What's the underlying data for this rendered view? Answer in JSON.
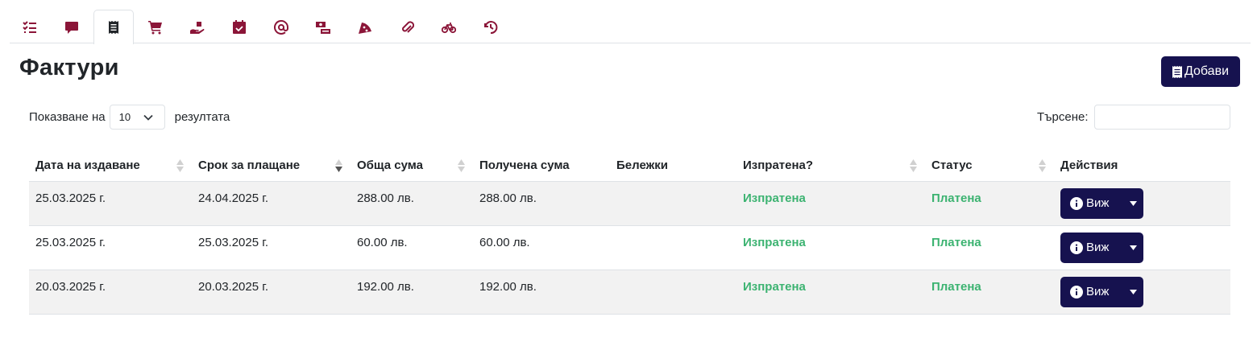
{
  "tabs": [
    {
      "icon": "tasks-icon",
      "active": false
    },
    {
      "icon": "comment-icon",
      "active": false
    },
    {
      "icon": "invoice-icon",
      "active": true
    },
    {
      "icon": "cart-icon",
      "active": false
    },
    {
      "icon": "hand-holding-icon",
      "active": false
    },
    {
      "icon": "calendar-check-icon",
      "active": false
    },
    {
      "icon": "at-icon",
      "active": false
    },
    {
      "icon": "money-transfer-icon",
      "active": false
    },
    {
      "icon": "pizza-icon",
      "active": false
    },
    {
      "icon": "paperclip-icon",
      "active": false
    },
    {
      "icon": "bicycle-icon",
      "active": false
    },
    {
      "icon": "history-icon",
      "active": false
    }
  ],
  "page": {
    "title": "Фактури",
    "add_label": "Добави"
  },
  "length": {
    "prefix": "Показване на",
    "value": "10",
    "suffix": "резултата"
  },
  "search": {
    "label": "Търсене:",
    "value": ""
  },
  "table": {
    "headers": [
      "Дата на издаване",
      "Срок за плащане",
      "Обща сума",
      "Получена сума",
      "Бележки",
      "Изпратена?",
      "Статус",
      "Действия"
    ],
    "rows": [
      {
        "issued": "25.03.2025 г.",
        "due": "24.04.2025 г.",
        "total": "288.00 лв.",
        "received": "288.00 лв.",
        "notes": "",
        "sent": "Изпратена",
        "status": "Платена",
        "action": "Виж"
      },
      {
        "issued": "25.03.2025 г.",
        "due": "25.03.2025 г.",
        "total": "60.00 лв.",
        "received": "60.00 лв.",
        "notes": "",
        "sent": "Изпратена",
        "status": "Платена",
        "action": "Виж"
      },
      {
        "issued": "20.03.2025 г.",
        "due": "20.03.2025 г.",
        "total": "192.00 лв.",
        "received": "192.00 лв.",
        "notes": "",
        "sent": "Изпратена",
        "status": "Платена",
        "action": "Виж"
      }
    ]
  },
  "colors": {
    "primary": "#16124f",
    "tab_icon": "#8b1538",
    "success": "#3cb371"
  }
}
